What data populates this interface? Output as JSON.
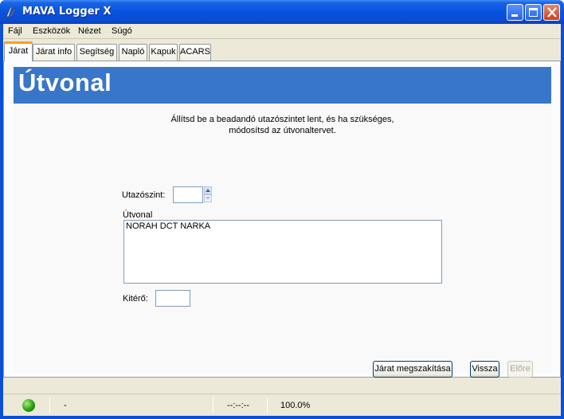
{
  "window": {
    "title": "MAVA Logger X"
  },
  "menu": [
    "Fájl",
    "Eszközök",
    "Nézet",
    "Súgó"
  ],
  "tabs": [
    "Járat",
    "Járat info",
    "Segítség",
    "Napló",
    "Kapuk",
    "ACARS"
  ],
  "active_tab": "Járat",
  "page": {
    "heading": "Útvonal",
    "instruction_line1": "Állítsd be a beadandó utazószintet lent, és ha szükséges,",
    "instruction_line2": "módosítsd az útvonaltervet.",
    "cruise_label": "Utazószint:",
    "cruise_value": "",
    "route_label": "Útvonal",
    "route_value": "NORAH DCT NARKA",
    "alternate_label": "Kitérő:",
    "alternate_value": ""
  },
  "buttons": {
    "abort": "Járat megszakítása",
    "back": "Vissza",
    "next": "Előre"
  },
  "status": {
    "message": "-",
    "time": "--:--:--",
    "zoom": "100.0%"
  },
  "colors": {
    "header_band": "#3876c9",
    "titlebar": "#0854e0",
    "status_led": "#2b9f0e"
  }
}
